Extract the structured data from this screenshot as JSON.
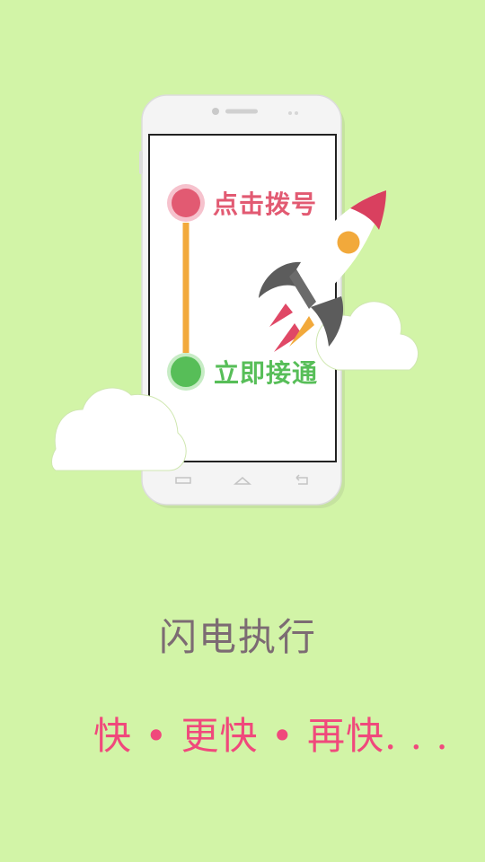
{
  "phone_card": {
    "step_dial_label": "点击拨号",
    "step_connect_label": "立即接通"
  },
  "headline": "闪电执行",
  "tagline": "快 • 更快 • 再快. . .",
  "icons": {
    "illustration": "phone-with-rocket-and-clouds",
    "rocket": "rocket-icon",
    "cloud": "cloud-icon"
  },
  "colors": {
    "background": "#d2f4a7",
    "dial_dot": "#e25a72",
    "connect_dot": "#57be58",
    "connector_line": "#f2a93b",
    "headline": "#7c6b73",
    "tagline": "#f0497c"
  }
}
